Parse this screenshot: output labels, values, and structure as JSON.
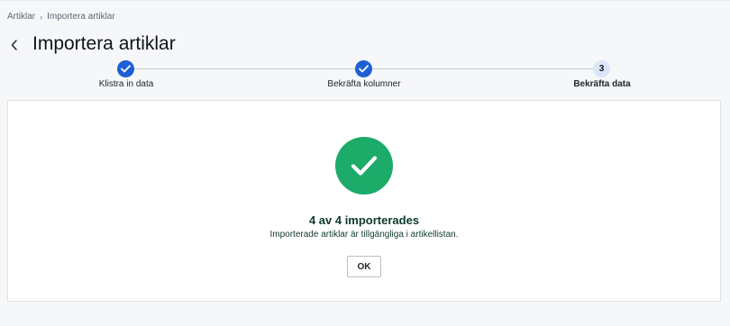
{
  "breadcrumb": {
    "items": [
      "Artiklar",
      "Importera artiklar"
    ],
    "separator": "›"
  },
  "header": {
    "back_icon": "chevron-left-icon",
    "title": "Importera artiklar"
  },
  "stepper": {
    "steps": [
      {
        "label": "Klistra in data",
        "status": "done",
        "icon": "check-icon"
      },
      {
        "label": "Bekräfta kolumner",
        "status": "done",
        "icon": "check-icon"
      },
      {
        "label": "Bekräfta data",
        "status": "current",
        "number": "3"
      }
    ]
  },
  "result": {
    "icon": "check-icon",
    "title": "4 av 4 importerades",
    "subtitle": "Importerade artiklar är tillgängliga i artikellistan.",
    "ok_label": "OK"
  },
  "colors": {
    "accent": "#1f5fd6",
    "success": "#1dab6a",
    "success_text": "#0d3a2b",
    "current_step_bg": "#dbe5f7"
  }
}
